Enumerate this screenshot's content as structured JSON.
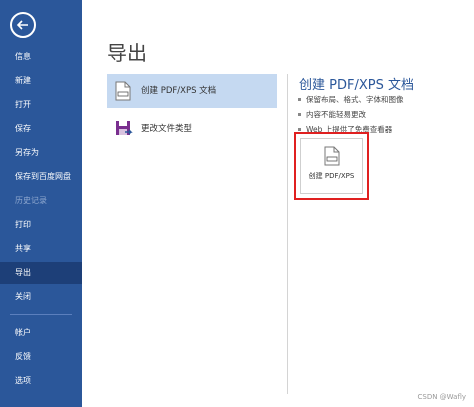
{
  "sidebar": {
    "items": [
      {
        "label": "信息"
      },
      {
        "label": "新建"
      },
      {
        "label": "打开"
      },
      {
        "label": "保存"
      },
      {
        "label": "另存为"
      },
      {
        "label": "保存到百度网盘"
      },
      {
        "label": "历史记录"
      },
      {
        "label": "打印"
      },
      {
        "label": "共享"
      },
      {
        "label": "导出"
      },
      {
        "label": "关闭"
      },
      {
        "label": "帐户"
      },
      {
        "label": "反馈"
      },
      {
        "label": "选项"
      }
    ]
  },
  "main": {
    "title": "导出",
    "options": [
      {
        "label": "创建 PDF/XPS 文档",
        "icon": "pdf-doc-icon"
      },
      {
        "label": "更改文件类型",
        "icon": "change-file-type-icon"
      }
    ],
    "detail": {
      "title": "创建 PDF/XPS 文档",
      "bullets": [
        "保留布局、格式、字体和图像",
        "内容不能轻易更改",
        "Web 上提供了免费查看器"
      ],
      "button_label": "创建 PDF/XPS"
    }
  },
  "watermark": "CSDN @Wafly",
  "colors": {
    "sidebar": "#2b579a",
    "sidebar_active": "#1d3f78",
    "selected_option": "#c5d9f1",
    "highlight_border": "#e02020"
  }
}
